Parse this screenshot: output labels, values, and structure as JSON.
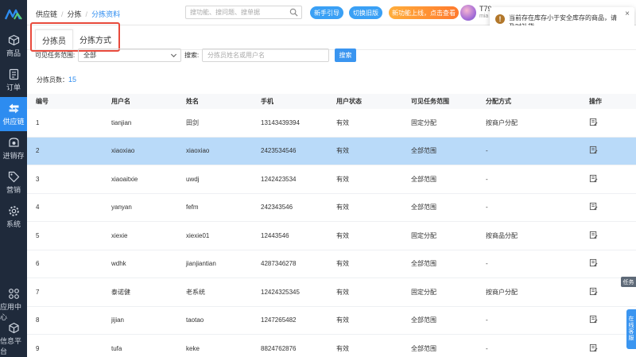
{
  "sidebar": {
    "items": [
      {
        "label": "商品",
        "icon": "box-icon"
      },
      {
        "label": "订单",
        "icon": "order-icon"
      },
      {
        "label": "供应链",
        "icon": "supply-chain-icon",
        "active": true
      },
      {
        "label": "进销存",
        "icon": "inventory-icon"
      },
      {
        "label": "营销",
        "icon": "tag-icon"
      },
      {
        "label": "系统",
        "icon": "gear-icon"
      }
    ],
    "bottom": [
      {
        "label": "应用中心",
        "icon": "app-grid-icon"
      },
      {
        "label": "信息平台",
        "icon": "cube-icon"
      }
    ]
  },
  "header": {
    "breadcrumb": [
      "供应链",
      "分拣",
      "分拣资料"
    ],
    "search_placeholder": "搜功能、搜问题、搜单据",
    "btn_guide": "新手引导",
    "btn_switch": "切换旧版",
    "btn_promo": "新功能上线，点击查看",
    "user_name": "T79",
    "user_sub": "mia"
  },
  "notification": {
    "text": "当前存在库存小于安全库存的商品，请及时补货",
    "close": "×"
  },
  "tabs": [
    "分拣员",
    "分拣方式"
  ],
  "filter": {
    "scope_label": "可见任务范围:",
    "scope_value": "全部",
    "search_label": "搜索:",
    "search_placeholder": "分拣员姓名或用户名",
    "search_btn": "搜索"
  },
  "count": {
    "label": "分拣员数：",
    "value": "15"
  },
  "table": {
    "headers": [
      "编号",
      "用户名",
      "姓名",
      "手机",
      "用户状态",
      "可见任务范围",
      "分配方式",
      "操作"
    ],
    "rows": [
      [
        "1",
        "tianjian",
        "田剑",
        "13143439394",
        "有效",
        "固定分配",
        "按商户分配"
      ],
      [
        "2",
        "xiaoxiao",
        "xiaoxiao",
        "2423534546",
        "有效",
        "全部范围",
        "-"
      ],
      [
        "3",
        "xiaoaitxie",
        "uwdj",
        "1242423534",
        "有效",
        "全部范围",
        "-"
      ],
      [
        "4",
        "yanyan",
        "fefm",
        "242343546",
        "有效",
        "全部范围",
        "-"
      ],
      [
        "5",
        "xiexie",
        "xiexie01",
        "12443546",
        "有效",
        "固定分配",
        "按商品分配"
      ],
      [
        "6",
        "wdhk",
        "jianjiantian",
        "4287346278",
        "有效",
        "全部范围",
        "-"
      ],
      [
        "7",
        "泰诺健",
        "老系统",
        "12424325345",
        "有效",
        "固定分配",
        "按商户分配"
      ],
      [
        "8",
        "jijian",
        "taotao",
        "1247265482",
        "有效",
        "全部范围",
        "-"
      ],
      [
        "9",
        "tufa",
        "keke",
        "8824762876",
        "有效",
        "全部范围",
        "-"
      ]
    ],
    "selected_row": 1
  },
  "float": {
    "task": "任务",
    "service": [
      "在",
      "线",
      "客",
      "服"
    ]
  },
  "colors": {
    "accent": "#2d8cf0",
    "sidebar": "#1f2a3b",
    "selected_row": "#b9daf9",
    "highlight_border": "#e84a3c"
  }
}
